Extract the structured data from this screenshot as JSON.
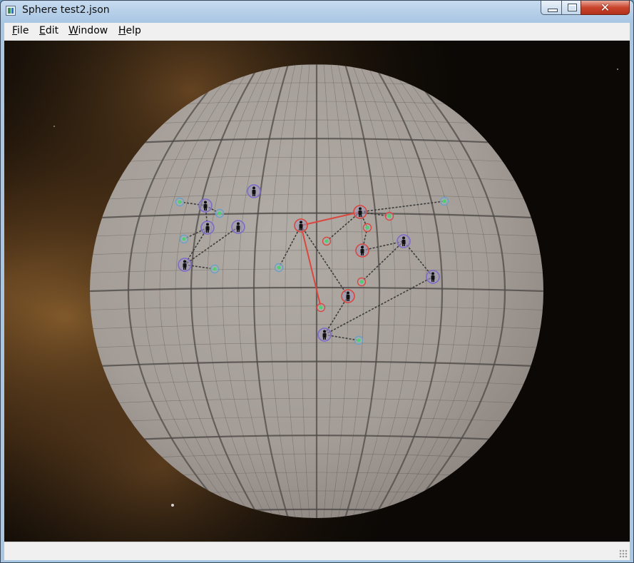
{
  "window": {
    "title": "Sphere test2.json",
    "controls": {
      "minimize": "minimize",
      "maximize": "maximize",
      "close": "✕"
    }
  },
  "menu": [
    {
      "accel": "F",
      "rest": "ile"
    },
    {
      "accel": "E",
      "rest": "dit"
    },
    {
      "accel": "W",
      "rest": "indow"
    },
    {
      "accel": "H",
      "rest": "elp"
    }
  ],
  "scene": {
    "background": "starfield-nebula",
    "object": "wireframe-sphere",
    "colors": {
      "sphere": "#a59f9a",
      "grid": "#4e4a47",
      "selected_edge": "#d9473f",
      "edge": "#3c3c3c",
      "person_ring": "#7d6cc8",
      "selected_ring": "#d9473f",
      "small_ring": "#6aa0c8",
      "small_dot": "#4fd070"
    }
  },
  "status": {
    "text": ""
  }
}
